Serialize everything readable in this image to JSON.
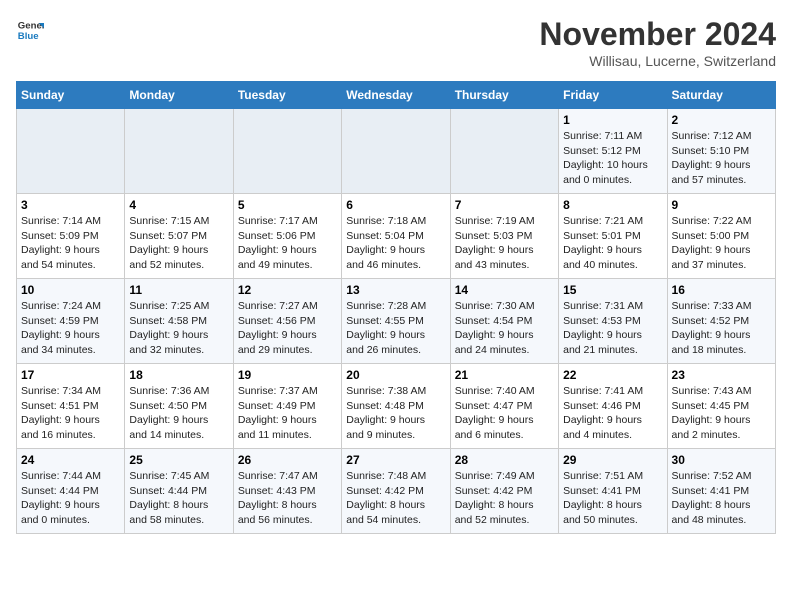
{
  "header": {
    "logo_general": "General",
    "logo_blue": "Blue",
    "month_title": "November 2024",
    "location": "Willisau, Lucerne, Switzerland"
  },
  "weekdays": [
    "Sunday",
    "Monday",
    "Tuesday",
    "Wednesday",
    "Thursday",
    "Friday",
    "Saturday"
  ],
  "weeks": [
    [
      {
        "day": "",
        "info": ""
      },
      {
        "day": "",
        "info": ""
      },
      {
        "day": "",
        "info": ""
      },
      {
        "day": "",
        "info": ""
      },
      {
        "day": "",
        "info": ""
      },
      {
        "day": "1",
        "info": "Sunrise: 7:11 AM\nSunset: 5:12 PM\nDaylight: 10 hours\nand 0 minutes."
      },
      {
        "day": "2",
        "info": "Sunrise: 7:12 AM\nSunset: 5:10 PM\nDaylight: 9 hours\nand 57 minutes."
      }
    ],
    [
      {
        "day": "3",
        "info": "Sunrise: 7:14 AM\nSunset: 5:09 PM\nDaylight: 9 hours\nand 54 minutes."
      },
      {
        "day": "4",
        "info": "Sunrise: 7:15 AM\nSunset: 5:07 PM\nDaylight: 9 hours\nand 52 minutes."
      },
      {
        "day": "5",
        "info": "Sunrise: 7:17 AM\nSunset: 5:06 PM\nDaylight: 9 hours\nand 49 minutes."
      },
      {
        "day": "6",
        "info": "Sunrise: 7:18 AM\nSunset: 5:04 PM\nDaylight: 9 hours\nand 46 minutes."
      },
      {
        "day": "7",
        "info": "Sunrise: 7:19 AM\nSunset: 5:03 PM\nDaylight: 9 hours\nand 43 minutes."
      },
      {
        "day": "8",
        "info": "Sunrise: 7:21 AM\nSunset: 5:01 PM\nDaylight: 9 hours\nand 40 minutes."
      },
      {
        "day": "9",
        "info": "Sunrise: 7:22 AM\nSunset: 5:00 PM\nDaylight: 9 hours\nand 37 minutes."
      }
    ],
    [
      {
        "day": "10",
        "info": "Sunrise: 7:24 AM\nSunset: 4:59 PM\nDaylight: 9 hours\nand 34 minutes."
      },
      {
        "day": "11",
        "info": "Sunrise: 7:25 AM\nSunset: 4:58 PM\nDaylight: 9 hours\nand 32 minutes."
      },
      {
        "day": "12",
        "info": "Sunrise: 7:27 AM\nSunset: 4:56 PM\nDaylight: 9 hours\nand 29 minutes."
      },
      {
        "day": "13",
        "info": "Sunrise: 7:28 AM\nSunset: 4:55 PM\nDaylight: 9 hours\nand 26 minutes."
      },
      {
        "day": "14",
        "info": "Sunrise: 7:30 AM\nSunset: 4:54 PM\nDaylight: 9 hours\nand 24 minutes."
      },
      {
        "day": "15",
        "info": "Sunrise: 7:31 AM\nSunset: 4:53 PM\nDaylight: 9 hours\nand 21 minutes."
      },
      {
        "day": "16",
        "info": "Sunrise: 7:33 AM\nSunset: 4:52 PM\nDaylight: 9 hours\nand 18 minutes."
      }
    ],
    [
      {
        "day": "17",
        "info": "Sunrise: 7:34 AM\nSunset: 4:51 PM\nDaylight: 9 hours\nand 16 minutes."
      },
      {
        "day": "18",
        "info": "Sunrise: 7:36 AM\nSunset: 4:50 PM\nDaylight: 9 hours\nand 14 minutes."
      },
      {
        "day": "19",
        "info": "Sunrise: 7:37 AM\nSunset: 4:49 PM\nDaylight: 9 hours\nand 11 minutes."
      },
      {
        "day": "20",
        "info": "Sunrise: 7:38 AM\nSunset: 4:48 PM\nDaylight: 9 hours\nand 9 minutes."
      },
      {
        "day": "21",
        "info": "Sunrise: 7:40 AM\nSunset: 4:47 PM\nDaylight: 9 hours\nand 6 minutes."
      },
      {
        "day": "22",
        "info": "Sunrise: 7:41 AM\nSunset: 4:46 PM\nDaylight: 9 hours\nand 4 minutes."
      },
      {
        "day": "23",
        "info": "Sunrise: 7:43 AM\nSunset: 4:45 PM\nDaylight: 9 hours\nand 2 minutes."
      }
    ],
    [
      {
        "day": "24",
        "info": "Sunrise: 7:44 AM\nSunset: 4:44 PM\nDaylight: 9 hours\nand 0 minutes."
      },
      {
        "day": "25",
        "info": "Sunrise: 7:45 AM\nSunset: 4:44 PM\nDaylight: 8 hours\nand 58 minutes."
      },
      {
        "day": "26",
        "info": "Sunrise: 7:47 AM\nSunset: 4:43 PM\nDaylight: 8 hours\nand 56 minutes."
      },
      {
        "day": "27",
        "info": "Sunrise: 7:48 AM\nSunset: 4:42 PM\nDaylight: 8 hours\nand 54 minutes."
      },
      {
        "day": "28",
        "info": "Sunrise: 7:49 AM\nSunset: 4:42 PM\nDaylight: 8 hours\nand 52 minutes."
      },
      {
        "day": "29",
        "info": "Sunrise: 7:51 AM\nSunset: 4:41 PM\nDaylight: 8 hours\nand 50 minutes."
      },
      {
        "day": "30",
        "info": "Sunrise: 7:52 AM\nSunset: 4:41 PM\nDaylight: 8 hours\nand 48 minutes."
      }
    ]
  ]
}
